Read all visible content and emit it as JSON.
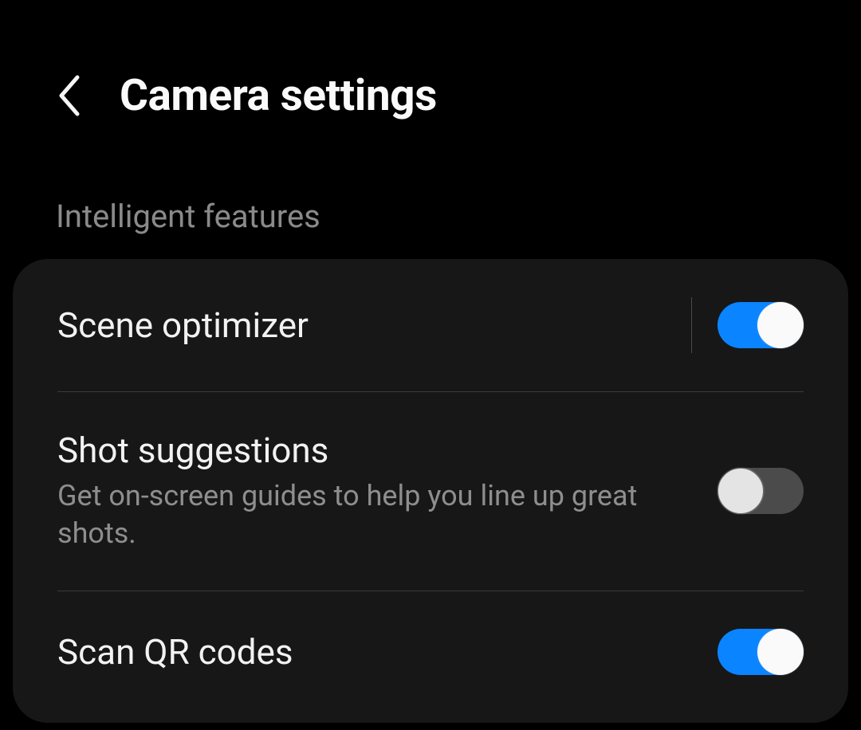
{
  "header": {
    "title": "Camera settings"
  },
  "section": {
    "label": "Intelligent features"
  },
  "items": [
    {
      "title": "Scene optimizer",
      "subtitle": "",
      "on": true,
      "hasDivider": true
    },
    {
      "title": "Shot suggestions",
      "subtitle": "Get on-screen guides to help you line up great shots.",
      "on": false,
      "hasDivider": false
    },
    {
      "title": "Scan QR codes",
      "subtitle": "",
      "on": true,
      "hasDivider": false
    }
  ]
}
